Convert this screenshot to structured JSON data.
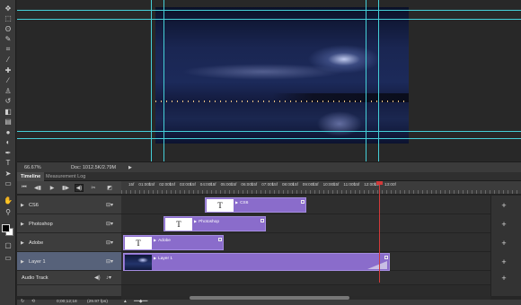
{
  "tools": [
    {
      "name": "move-tool-icon",
      "glyph": "✥"
    },
    {
      "name": "marquee-tool-icon",
      "glyph": "⬚"
    },
    {
      "name": "lasso-tool-icon",
      "glyph": "ʘ"
    },
    {
      "name": "quick-select-tool-icon",
      "glyph": "✎"
    },
    {
      "name": "crop-tool-icon",
      "glyph": "⌗"
    },
    {
      "name": "eyedropper-tool-icon",
      "glyph": "⁄"
    },
    {
      "name": "healing-brush-tool-icon",
      "glyph": "✚"
    },
    {
      "name": "brush-tool-icon",
      "glyph": "∕"
    },
    {
      "name": "clone-stamp-tool-icon",
      "glyph": "♙"
    },
    {
      "name": "history-brush-tool-icon",
      "glyph": "↺"
    },
    {
      "name": "eraser-tool-icon",
      "glyph": "◧"
    },
    {
      "name": "gradient-tool-icon",
      "glyph": "▤"
    },
    {
      "name": "blur-tool-icon",
      "glyph": "●"
    },
    {
      "name": "dodge-tool-icon",
      "glyph": "◐"
    },
    {
      "name": "pen-tool-icon",
      "glyph": "✒"
    },
    {
      "name": "type-tool-icon",
      "glyph": "T"
    },
    {
      "name": "path-select-tool-icon",
      "glyph": "➤"
    },
    {
      "name": "shape-tool-icon",
      "glyph": "▭"
    },
    {
      "name": "hand-tool-icon",
      "glyph": "✋"
    },
    {
      "name": "zoom-tool-icon",
      "glyph": "⚲"
    }
  ],
  "status": {
    "zoom": "66.67%",
    "doc": "Doc: 1012.5K/2.79M"
  },
  "panel_tabs": {
    "timeline": "Timeline",
    "measurement_log": "Measurement Log"
  },
  "ruler_labels": [
    "15f",
    "01:00f",
    "15f",
    "02:00f",
    "15f",
    "03:00f",
    "15f",
    "04:00f",
    "15f",
    "05:00f",
    "15f",
    "06:00f",
    "15f",
    "07:00f",
    "15f",
    "08:00f",
    "15f",
    "09:00f",
    "15f",
    "10:00f",
    "15f",
    "11:00f",
    "15f",
    "12:00f",
    "15f",
    "13:00f"
  ],
  "tracks": [
    {
      "name": "CS6",
      "clip_label": "CS6"
    },
    {
      "name": "Photoshop",
      "clip_label": "Photoshop"
    },
    {
      "name": "Adobe",
      "clip_label": "Adobe"
    },
    {
      "name": "Layer 1",
      "clip_label": "Layer 1"
    }
  ],
  "audio_track": {
    "name": "Audio Track"
  },
  "bottom": {
    "timecode": "0;00;12;18",
    "fps": "(29.97 fps)"
  },
  "colors": {
    "guide": "#45cfd8",
    "clip": "#8a6ccb",
    "playhead": "#d23a3a",
    "selected_track": "#57627a"
  }
}
